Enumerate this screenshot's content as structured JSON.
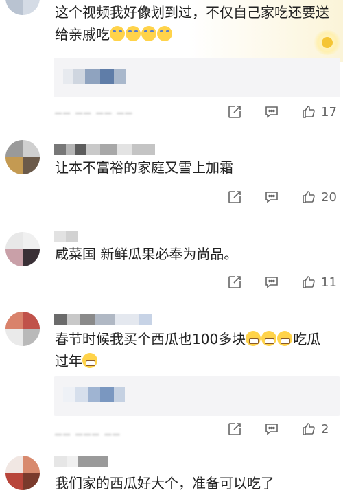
{
  "comments": [
    {
      "text": "这个视频我好像划到过，不仅自己家吃还要送给亲戚吃",
      "emojis": [
        "cry-laugh-emoji",
        "cry-laugh-emoji",
        "cry-laugh-emoji",
        "cry-laugh-emoji"
      ],
      "has_reply_box": true,
      "likes": "17"
    },
    {
      "text": "让本不富裕的家庭又雪上加霜",
      "likes": "20"
    },
    {
      "text": "咸菜国 新鲜瓜果必奉为尚品。",
      "likes": "11"
    },
    {
      "text_line1": "春节时候我买个西瓜也100多块",
      "text_line2_a": "吃瓜",
      "text_line2_b": "过年",
      "emojis": [
        "grin-emoji",
        "grin-emoji",
        "grin-emoji",
        "grin-emoji"
      ],
      "has_reply_box": true,
      "likes": "2"
    },
    {
      "text": "我们家的西瓜好大个，准备可以吃了"
    }
  ],
  "icons": {
    "share": "share-icon",
    "comment": "comment-icon",
    "like": "thumbs-up-icon",
    "badge": "fan-badge-icon"
  },
  "colors": {
    "text": "#222222",
    "muted": "#666666",
    "reply_bg": "#f4f4f6",
    "badge": "#f5c535"
  }
}
